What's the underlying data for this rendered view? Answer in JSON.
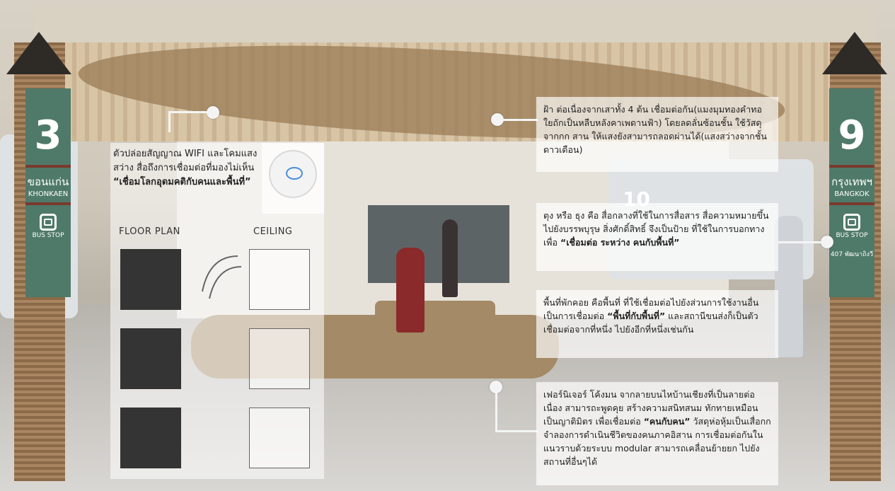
{
  "left_sign": {
    "number": "3",
    "city_th": "ขอนแก่น",
    "city_en": "KHONKAEN",
    "stop_label": "BUS STOP"
  },
  "right_sign": {
    "number": "9",
    "city_th": "กรุงเทพฯ",
    "city_en": "BANGKOK",
    "stop_label": "BUS STOP",
    "address": "407 พัฒนาถิงวี"
  },
  "platform_number": "10",
  "wifi_box": {
    "text": "ตัวปล่อยสัญญาณ WIFI และโคมแสงสว่าง สื่อถึงการเชื่อมต่อที่มองไม่เห็น",
    "bold": "“เชื่อมโลกอุดมคติกับคนและพื้นที่”"
  },
  "plan_labels": {
    "floor": "FLOOR PLAN",
    "ceiling": "CEILING"
  },
  "ceiling_box": {
    "text": "ฝ้า ต่อเนื่องจากเสาทั้ง 4 ต้น เชื่อมต่อกัน(แมงมุมทองคำทอใยถักเป็นหลืบหลังคาเพดานฟ้า) โดยลดลั่นซ้อนชั้น ใช้วัสดุจากกก สาน ให้แสงยังสามารถลอดผ่านได้(แสงสว่างจากชั้นดาวเดือน)"
  },
  "flag_box": {
    "text": "ตุง หรือ ธุง คือ สื่อกลางที่ใช้ในการสื่อสาร สื่อความหมายขึ้นไปยังบรรพบุรุษ สิ่งศักดิ์สิทธิ์ จึงเป็นป้าย ที่ใช้ในการบอกทางเพื่อ",
    "bold": "“เชื่อมต่อ ระหว่าง คนกับพื้นที่”"
  },
  "rest_box": {
    "text_1": "พื้นที่พักคอย คือพื้นที่ ที่ใช้เชื่อมต่อไปยังส่วนการใช้งานอื่น เป็นการเชื่อมต่อ",
    "bold": "“พื้นที่กับพื้นที่”",
    "text_2": "และสถานีขนส่งก็เป็นตัวเชื่อมต่อจากที่หนึ่ง ไปยังอีกที่หนึ่งเช่นกัน"
  },
  "furniture_box": {
    "text_1": "เฟอร์นิเจอร์ โค้งมน จากลายบนไหบ้านเชียงที่เป็นลายต่อเนื่อง สามารถะพูดคุย สร้างความสนิทสนม ทักทายเหมือนเป็นญาติมิตร เพื่อเชื่อมต่อ",
    "bold": "“คนกับคน”",
    "text_2": "วัสดุห่อหุ้มเป็นเสื่อกก จำลองการดำเนินชีวิตของคนภาคอิสาน การเชื่อมต่อกันในแนวราบด้วยระบบ modular สามารถเคลื่อนย้ายยก ไปยังสถานที่อื่นๆได้"
  }
}
